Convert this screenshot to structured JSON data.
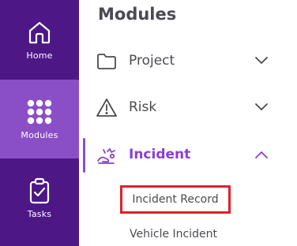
{
  "rail": {
    "items": [
      {
        "label": "Home",
        "icon": "home-icon",
        "active": false
      },
      {
        "label": "Modules",
        "icon": "grid-dots-icon",
        "active": true
      },
      {
        "label": "Tasks",
        "icon": "clipboard-check-icon",
        "active": false
      }
    ]
  },
  "panel": {
    "title": "Modules",
    "modules": [
      {
        "label": "Project",
        "icon": "folder-icon",
        "expanded": false
      },
      {
        "label": "Risk",
        "icon": "warning-icon",
        "expanded": false
      },
      {
        "label": "Incident",
        "icon": "incident-icon",
        "expanded": true
      }
    ],
    "incident_subitems": [
      {
        "label": "Incident Record",
        "highlighted": true
      },
      {
        "label": "Vehicle Incident",
        "highlighted": false
      }
    ]
  },
  "colors": {
    "rail_bg": "#4d1786",
    "rail_active_bg": "#8a4fc7",
    "accent": "#8a3fd0",
    "highlight_border": "#e0202b",
    "text": "#4a4a52"
  }
}
